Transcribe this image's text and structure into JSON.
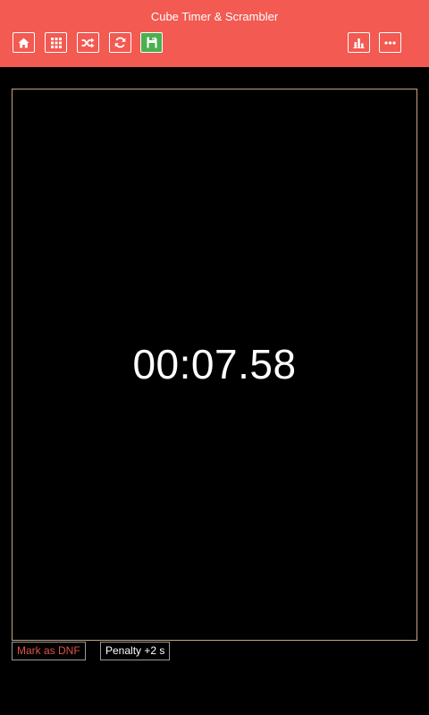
{
  "app": {
    "title": "Cube Timer & Scrambler"
  },
  "toolbar": {
    "left_buttons": [
      {
        "icon": "home-icon",
        "label": "Home"
      },
      {
        "icon": "grid-icon",
        "label": "Puzzle select"
      },
      {
        "icon": "shuffle-icon",
        "label": "Scramble"
      },
      {
        "icon": "refresh-icon",
        "label": "Reset"
      },
      {
        "icon": "save-icon",
        "label": "Save",
        "active": true
      }
    ],
    "right_buttons": [
      {
        "icon": "stats-icon",
        "label": "Statistics"
      },
      {
        "icon": "more-icon",
        "label": "More"
      }
    ]
  },
  "timer": {
    "time": "00:07.58"
  },
  "actions": {
    "dnf_label": "Mark as DNF",
    "penalty_label": "Penalty +2 s"
  },
  "colors": {
    "header_bg": "#f25a52",
    "save_active_bg": "#4caf50",
    "timer_border": "#c8a27a",
    "dnf_text": "#e0524b",
    "background": "#000000"
  }
}
